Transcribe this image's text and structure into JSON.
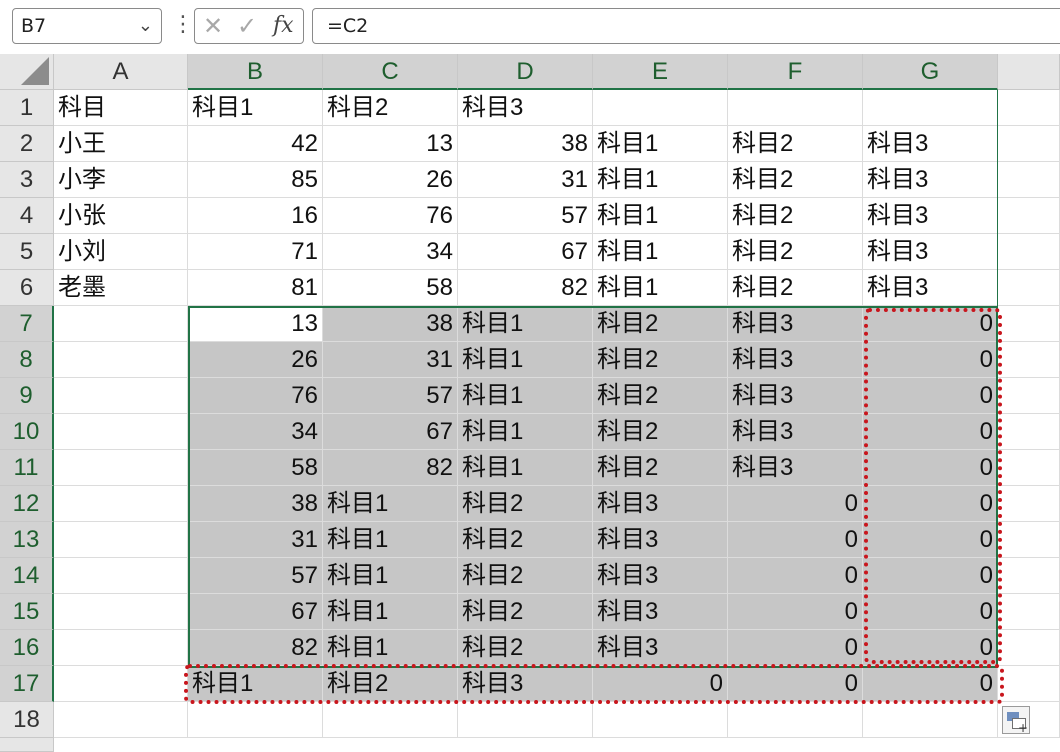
{
  "formula_bar": {
    "name_box": "B7",
    "formula": "=C2"
  },
  "columns": [
    "A",
    "B",
    "C",
    "D",
    "E",
    "F",
    "G"
  ],
  "rows": [
    "1",
    "2",
    "3",
    "4",
    "5",
    "6",
    "7",
    "8",
    "9",
    "10",
    "11",
    "12",
    "13",
    "14",
    "15",
    "16",
    "17",
    "18"
  ],
  "cells": [
    [
      "科目",
      "科目1",
      "科目2",
      "科目3",
      "",
      "",
      ""
    ],
    [
      "小王",
      "42",
      "13",
      "38",
      "科目1",
      "科目2",
      "科目3"
    ],
    [
      "小李",
      "85",
      "26",
      "31",
      "科目1",
      "科目2",
      "科目3"
    ],
    [
      "小张",
      "16",
      "76",
      "57",
      "科目1",
      "科目2",
      "科目3"
    ],
    [
      "小刘",
      "71",
      "34",
      "67",
      "科目1",
      "科目2",
      "科目3"
    ],
    [
      "老墨",
      "81",
      "58",
      "82",
      "科目1",
      "科目2",
      "科目3"
    ],
    [
      "",
      "13",
      "38",
      "科目1",
      "科目2",
      "科目3",
      "0"
    ],
    [
      "",
      "26",
      "31",
      "科目1",
      "科目2",
      "科目3",
      "0"
    ],
    [
      "",
      "76",
      "57",
      "科目1",
      "科目2",
      "科目3",
      "0"
    ],
    [
      "",
      "34",
      "67",
      "科目1",
      "科目2",
      "科目3",
      "0"
    ],
    [
      "",
      "58",
      "82",
      "科目1",
      "科目2",
      "科目3",
      "0"
    ],
    [
      "",
      "38",
      "科目1",
      "科目2",
      "科目3",
      "0",
      "0"
    ],
    [
      "",
      "31",
      "科目1",
      "科目2",
      "科目3",
      "0",
      "0"
    ],
    [
      "",
      "57",
      "科目1",
      "科目2",
      "科目3",
      "0",
      "0"
    ],
    [
      "",
      "67",
      "科目1",
      "科目2",
      "科目3",
      "0",
      "0"
    ],
    [
      "",
      "82",
      "科目1",
      "科目2",
      "科目3",
      "0",
      "0"
    ],
    [
      "",
      "科目1",
      "科目2",
      "科目3",
      "0",
      "0",
      "0"
    ],
    [
      "",
      "",
      "",
      "",
      "",
      "",
      ""
    ]
  ],
  "selection": {
    "active_cell": "B7",
    "range": "B7:G17"
  },
  "colors": {
    "selection_border": "#217346",
    "selection_fill": "#c6c6c6",
    "highlight_dotted": "#c8161d"
  },
  "icons": {
    "cancel": "close-icon",
    "enter": "check-icon",
    "function": "fx-icon",
    "paste_options": "paste-options-icon"
  }
}
